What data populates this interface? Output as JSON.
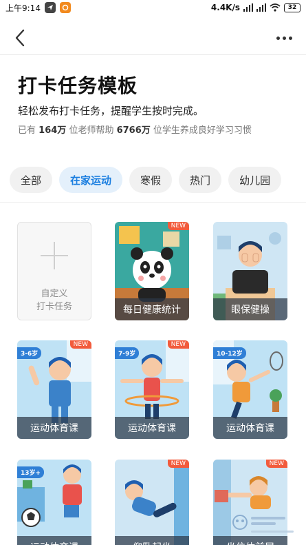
{
  "status_bar": {
    "time": "上午9:14",
    "network_speed": "4.4K/s",
    "battery": "32"
  },
  "header": {
    "title": "打卡任务模板",
    "subtitle": "轻松发布打卡任务，提醒学生按时完成。",
    "stats": {
      "prefix": "已有",
      "teachers_count": "164万",
      "middle": "位老师帮助",
      "students_count": "6766万",
      "suffix": "位学生养成良好学习习惯"
    }
  },
  "tabs": [
    {
      "label": "全部",
      "active": false
    },
    {
      "label": "在家运动",
      "active": true
    },
    {
      "label": "寒假",
      "active": false
    },
    {
      "label": "热门",
      "active": false
    },
    {
      "label": "幼儿园",
      "active": false
    }
  ],
  "custom_card": {
    "line1": "自定义",
    "line2": "打卡任务"
  },
  "cards": [
    {
      "label": "每日健康统计",
      "badge": "NEW",
      "age": "",
      "theme": "panda"
    },
    {
      "label": "眼保健操",
      "badge": "",
      "age": "",
      "theme": "eye"
    },
    {
      "label": "运动体育课",
      "badge": "NEW",
      "age": "3-6岁",
      "theme": "kid-wave"
    },
    {
      "label": "运动体育课",
      "badge": "NEW",
      "age": "7-9岁",
      "theme": "kid-hoop"
    },
    {
      "label": "运动体育课",
      "badge": "",
      "age": "10-12岁",
      "theme": "kid-badminton"
    },
    {
      "label": "运动体育课",
      "badge": "",
      "age": "13岁+",
      "theme": "kid-soccer"
    },
    {
      "label": "仰卧起坐",
      "badge": "NEW",
      "age": "",
      "theme": "situp"
    },
    {
      "label": "坐位体前屈",
      "badge": "NEW",
      "age": "",
      "theme": "stretch"
    }
  ],
  "colors": {
    "accent": "#1a7ee0",
    "tab_active_bg": "#e4f0fb",
    "new_badge": "#f25b3c",
    "age_badge": "#2f7fd6"
  }
}
